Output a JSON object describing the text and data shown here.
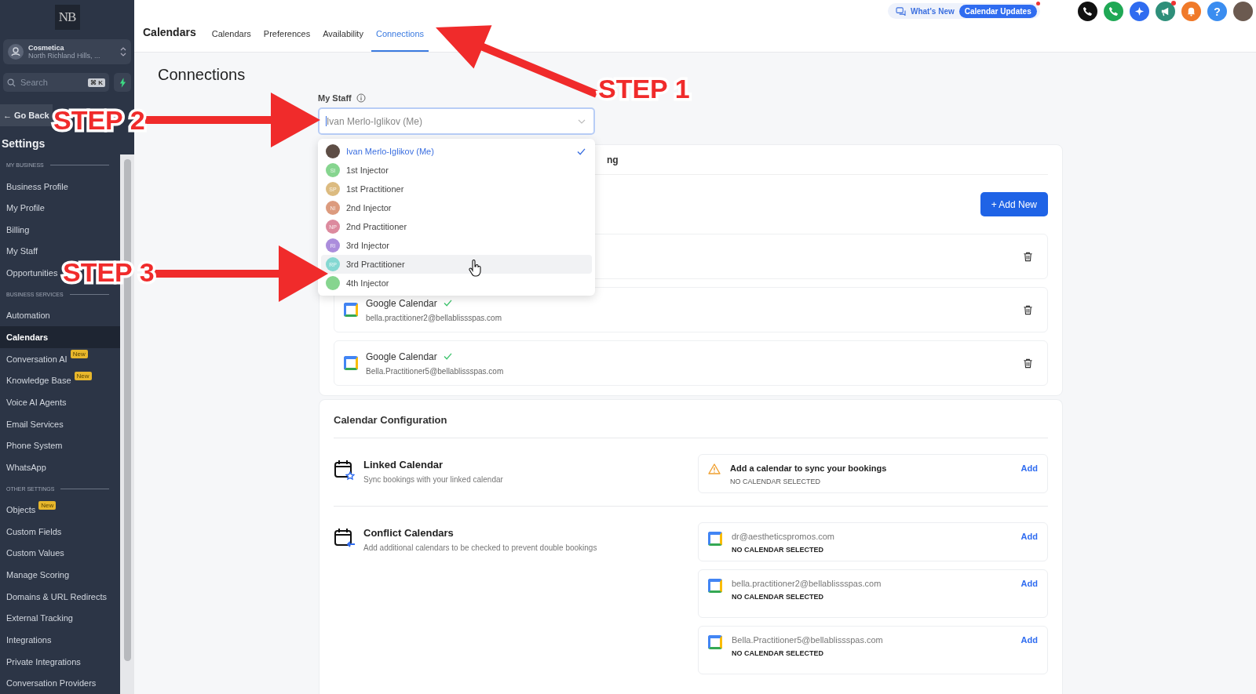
{
  "sidebar": {
    "logo": "NB",
    "account": {
      "name": "Cosmetica",
      "location": "North Richland Hills, ..."
    },
    "search": {
      "placeholder": "Search",
      "shortcut": "⌘ K"
    },
    "back_arrow": "←",
    "back": "Go Back",
    "title": "Settings",
    "sections": [
      {
        "title": "MY BUSINESS",
        "items": [
          {
            "label": "Business Profile",
            "selected": false
          },
          {
            "label": "My Profile",
            "selected": false
          },
          {
            "label": "Billing",
            "selected": false
          },
          {
            "label": "My Staff",
            "selected": false
          },
          {
            "label": "Opportunities",
            "selected": false
          }
        ]
      },
      {
        "title": "BUSINESS SERVICES",
        "items": [
          {
            "label": "Automation",
            "selected": false
          },
          {
            "label": "Calendars",
            "selected": true
          },
          {
            "label": "Conversation AI",
            "selected": false,
            "badge": "New"
          },
          {
            "label": "Knowledge Base",
            "selected": false,
            "badge": "New"
          },
          {
            "label": "Voice AI Agents",
            "selected": false
          },
          {
            "label": "Email Services",
            "selected": false
          },
          {
            "label": "Phone System",
            "selected": false
          },
          {
            "label": "WhatsApp",
            "selected": false
          }
        ]
      },
      {
        "title": "OTHER SETTINGS",
        "items": [
          {
            "label": "Objects",
            "selected": false,
            "badge": "New"
          },
          {
            "label": "Custom Fields",
            "selected": false
          },
          {
            "label": "Custom Values",
            "selected": false
          },
          {
            "label": "Manage Scoring",
            "selected": false
          },
          {
            "label": "Domains & URL Redirects",
            "selected": false
          },
          {
            "label": "External Tracking",
            "selected": false
          },
          {
            "label": "Integrations",
            "selected": false
          },
          {
            "label": "Private Integrations",
            "selected": false
          },
          {
            "label": "Conversation Providers",
            "selected": false
          }
        ]
      }
    ]
  },
  "topbar": {
    "title": "Calendars",
    "tabs": [
      {
        "label": "Calendars",
        "selected": false
      },
      {
        "label": "Preferences",
        "selected": false
      },
      {
        "label": "Availability",
        "selected": false
      },
      {
        "label": "Connections",
        "selected": true
      }
    ],
    "whats_new": "What's New",
    "updates": "Calendar Updates",
    "icons": [
      {
        "kind": "phone",
        "color": "#111111"
      },
      {
        "kind": "phone",
        "color": "#1fa855"
      },
      {
        "kind": "sparkle",
        "color": "#2f6cf0"
      },
      {
        "kind": "megaphone",
        "color": "#2e8f7a",
        "dot": true
      },
      {
        "kind": "bell",
        "color": "#f07a2a"
      },
      {
        "kind": "help",
        "color": "#3b8df0",
        "glyph": "?"
      },
      {
        "kind": "avatar",
        "color": "#6b5a50"
      }
    ]
  },
  "page": {
    "title": "Connections",
    "staff": {
      "label": "My Staff",
      "value": "Ivan Merlo-Iglikov (Me)",
      "options": [
        {
          "name": "Ivan Merlo-Iglikov (Me)",
          "kind": "photo",
          "selected": true,
          "hovered": false
        },
        {
          "name": "1st Injector",
          "initials": "SI",
          "color": "#86d58f",
          "selected": false,
          "hovered": false
        },
        {
          "name": "1st Practitioner",
          "initials": "SP",
          "color": "#dcbb80",
          "selected": false,
          "hovered": false
        },
        {
          "name": "2nd Injector",
          "initials": "NI",
          "color": "#dc9b7e",
          "selected": false,
          "hovered": false
        },
        {
          "name": "2nd Practitioner",
          "initials": "NP",
          "color": "#dc8a9e",
          "selected": false,
          "hovered": false
        },
        {
          "name": "3rd Injector",
          "initials": "RI",
          "color": "#ab8ddc",
          "selected": false,
          "hovered": false
        },
        {
          "name": "3rd Practitioner",
          "initials": "RP",
          "color": "#84d8d2",
          "selected": false,
          "hovered": true
        },
        {
          "name": "4th Injector",
          "color": "#86d58f",
          "selected": false,
          "hovered": false
        }
      ]
    }
  },
  "connections_card": {
    "title_fragment": "ng",
    "add_button": "+ Add New",
    "rows": [
      {
        "kind": "covered"
      },
      {
        "kind": "google",
        "title": "Google Calendar",
        "email": "bella.practitioner2@bellablissspas.com",
        "connected": true
      },
      {
        "kind": "google",
        "title": "Google Calendar",
        "email": "Bella.Practitioner5@bellablissspas.com",
        "connected": true
      }
    ]
  },
  "config": {
    "title": "Calendar Configuration",
    "linked": {
      "title": "Linked Calendar",
      "description": "Sync bookings with your linked calendar",
      "entries": [
        {
          "kind": "warning",
          "title": "Add a calendar to sync your bookings",
          "status": "NO CALENDAR SELECTED",
          "action": "Add"
        }
      ]
    },
    "conflict": {
      "title": "Conflict Calendars",
      "description": "Add additional calendars to be checked to prevent double bookings",
      "entries": [
        {
          "kind": "google",
          "title": "dr@aestheticspromos.com",
          "status": "NO CALENDAR SELECTED",
          "action": "Add"
        },
        {
          "kind": "google",
          "title": "bella.practitioner2@bellablissspas.com",
          "status": "NO CALENDAR SELECTED",
          "action": "Add"
        },
        {
          "kind": "google",
          "title": "Bella.Practitioner5@bellablissspas.com",
          "status": "NO CALENDAR SELECTED",
          "action": "Add"
        }
      ]
    }
  },
  "annotations": [
    {
      "label": "STEP 1"
    },
    {
      "label": "STEP 2"
    },
    {
      "label": "STEP 3"
    }
  ]
}
